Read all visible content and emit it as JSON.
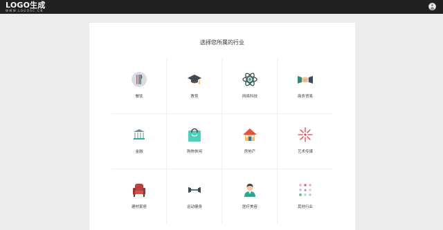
{
  "header": {
    "logo_main": "LOGO生成",
    "logo_sub": "WWW.LOGOSC.CN"
  },
  "main": {
    "title": "选择您所属的行业",
    "industries": [
      {
        "label": "餐饮",
        "icon": "utensils-icon"
      },
      {
        "label": "教育",
        "icon": "graduation-cap-icon"
      },
      {
        "label": "网络科技",
        "icon": "atom-icon"
      },
      {
        "label": "商务贸易",
        "icon": "handshake-icon"
      },
      {
        "label": "金融",
        "icon": "bank-icon"
      },
      {
        "label": "购物休闲",
        "icon": "shopping-bag-icon"
      },
      {
        "label": "房地产",
        "icon": "house-icon"
      },
      {
        "label": "艺术传媒",
        "icon": "firework-icon"
      },
      {
        "label": "建材家居",
        "icon": "armchair-icon"
      },
      {
        "label": "运动健身",
        "icon": "dumbbell-icon"
      },
      {
        "label": "医疗美容",
        "icon": "doctor-icon"
      },
      {
        "label": "其他行业",
        "icon": "dots-grid-icon"
      }
    ]
  },
  "colors": {
    "topbar": "#222121",
    "page_bg": "#ececec",
    "card_bg": "#ffffff"
  }
}
